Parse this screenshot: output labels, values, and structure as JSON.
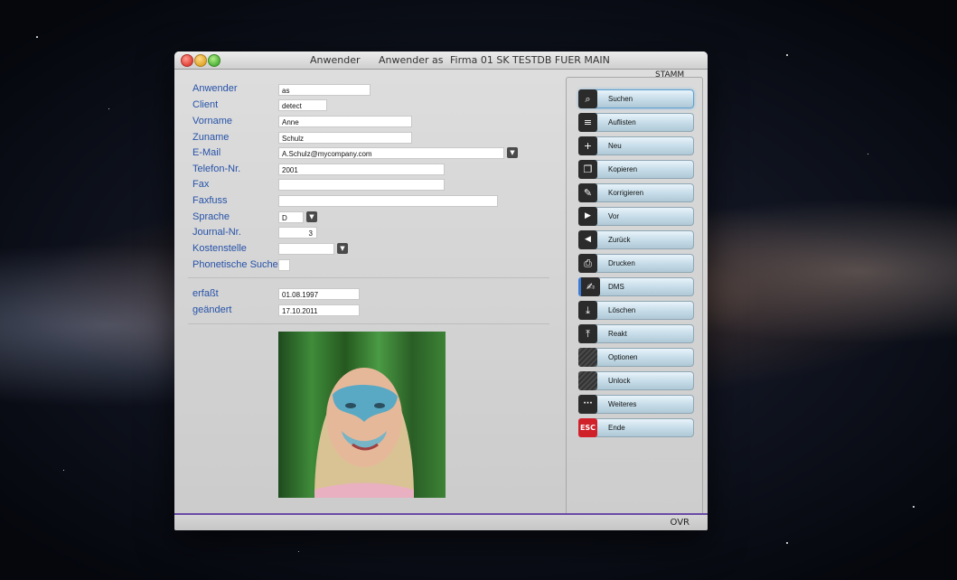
{
  "window": {
    "title_parts": [
      "Anwender",
      "Anwender as",
      "Firma 01 SK TESTDB FUER MAIN"
    ],
    "section": "STAMM",
    "status": "OVR"
  },
  "form": {
    "anwender": {
      "label": "Anwender",
      "value": "as"
    },
    "client": {
      "label": "Client",
      "value": "detect"
    },
    "vorname": {
      "label": "Vorname",
      "value": "Anne"
    },
    "zuname": {
      "label": "Zuname",
      "value": "Schulz"
    },
    "email": {
      "label": "E-Mail",
      "value": "A.Schulz@mycompany.com"
    },
    "telefon": {
      "label": "Telefon-Nr.",
      "value": "2001"
    },
    "fax": {
      "label": "Fax",
      "value": ""
    },
    "faxfuss": {
      "label": "Faxfuss",
      "value": ""
    },
    "sprache": {
      "label": "Sprache",
      "value": "D"
    },
    "journal": {
      "label": "Journal-Nr.",
      "value": "3"
    },
    "kostenstelle": {
      "label": "Kostenstelle",
      "value": ""
    },
    "phonetisch": {
      "label": "Phonetische Suche"
    },
    "erfasst": {
      "label": "erfaßt",
      "value": "01.08.1997"
    },
    "geaendert": {
      "label": "geändert",
      "value": "17.10.2011"
    }
  },
  "buttons": [
    {
      "label": "Suchen",
      "icon": "search-icon",
      "glyph": "⌕"
    },
    {
      "label": "Auflisten",
      "icon": "list-icon",
      "glyph": "≡"
    },
    {
      "label": "Neu",
      "icon": "plus-icon",
      "glyph": "+"
    },
    {
      "label": "Kopieren",
      "icon": "copy-icon",
      "glyph": "❐"
    },
    {
      "label": "Korrigieren",
      "icon": "pencil-icon",
      "glyph": "✎"
    },
    {
      "label": "Vor",
      "icon": "arrow-right-icon",
      "glyph": "▶"
    },
    {
      "label": "Zurück",
      "icon": "arrow-left-icon",
      "glyph": "◀"
    },
    {
      "label": "Drucken",
      "icon": "printer-icon",
      "glyph": "⎙"
    },
    {
      "label": "DMS",
      "icon": "document-edit-icon",
      "glyph": "✍"
    },
    {
      "label": "Löschen",
      "icon": "tray-down-icon",
      "glyph": "⤓"
    },
    {
      "label": "Reakt",
      "icon": "tray-up-icon",
      "glyph": "⤒"
    },
    {
      "label": "Optionen",
      "icon": "options-icon",
      "glyph": ""
    },
    {
      "label": "Unlock",
      "icon": "unlock-icon",
      "glyph": ""
    },
    {
      "label": "Weiteres",
      "icon": "more-icon",
      "glyph": "···"
    },
    {
      "label": "Ende",
      "icon": "esc-icon",
      "glyph": "ESC"
    }
  ]
}
